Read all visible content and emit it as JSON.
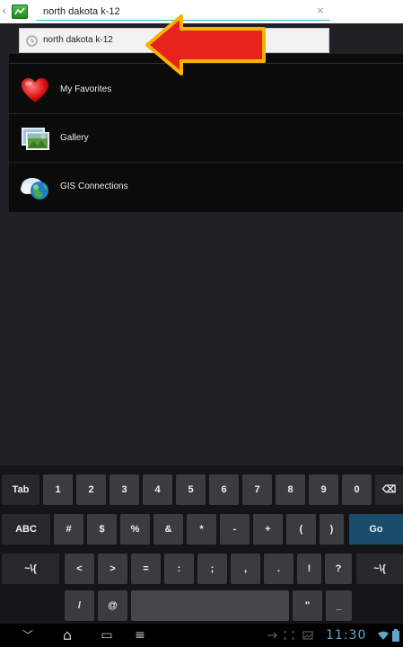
{
  "search": {
    "query": "north dakota k-12",
    "clear_glyph": "×",
    "back_glyph": "‹"
  },
  "suggestion": {
    "text": "north dakota k-12",
    "icon": "clock-icon"
  },
  "annotation": {
    "color": "#e8231c",
    "outline_color": "#f7b500"
  },
  "list": {
    "items": [
      {
        "label": "My Favorites",
        "icon": "heart-icon"
      },
      {
        "label": "Gallery",
        "icon": "gallery-icon"
      },
      {
        "label": "GIS Connections",
        "icon": "globe-icon"
      }
    ]
  },
  "keyboard": {
    "row1": [
      "Tab",
      "1",
      "2",
      "3",
      "4",
      "5",
      "6",
      "7",
      "8",
      "9",
      "0",
      "⌫"
    ],
    "row2": [
      "ABC",
      "#",
      "$",
      "%",
      "&",
      "*",
      "-",
      "+",
      "(",
      ")",
      "Go"
    ],
    "row3": [
      "~\\{",
      "<",
      ">",
      "=",
      ":",
      ";",
      ",",
      ".",
      "!",
      "?",
      "~\\{"
    ],
    "row4": [
      "/",
      "@",
      "",
      "\"",
      "_"
    ]
  },
  "navbar": {
    "back_glyph": "﹀",
    "home_glyph": "⌂",
    "recent_glyph": "▭",
    "menu_glyph": "≡",
    "time": "11:30"
  }
}
